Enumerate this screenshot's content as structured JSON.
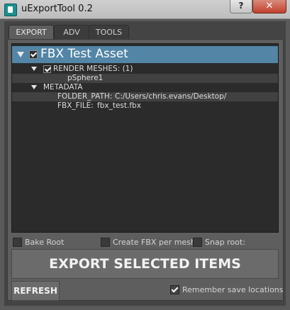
{
  "window": {
    "title": "uExportTool 0.2",
    "help_label": "?",
    "close_label": "✕"
  },
  "tabs": [
    {
      "label": "EXPORT",
      "active": true
    },
    {
      "label": "ADV",
      "active": false
    },
    {
      "label": "TOOLS",
      "active": false
    }
  ],
  "tree": {
    "root": {
      "label": "FBX Test Asset",
      "checked": true
    },
    "render_meshes": {
      "label": "RENDER MESHES: (1)",
      "checked": true
    },
    "mesh_item": "pSphere1",
    "metadata": {
      "label": "METADATA"
    },
    "folder_path": {
      "key": "FOLDER_PATH:",
      "value": "C:/Users/chris.evans/Desktop/"
    },
    "fbx_file": {
      "key": "FBX_FILE:",
      "value": "fbx_test.fbx"
    }
  },
  "options": {
    "bake_root": {
      "label": "Bake Root",
      "checked": false
    },
    "create_fbx_per_mesh": {
      "label": "Create FBX per mesh",
      "checked": false
    },
    "snap_root": {
      "label": "Snap root:",
      "checked": false
    }
  },
  "buttons": {
    "export_selected": "EXPORT SELECTED ITEMS",
    "refresh": "REFRESH"
  },
  "remember_save_locations": {
    "label": "Remember save locations",
    "checked": true
  },
  "colors": {
    "selection_highlight": "#5285a6",
    "background": "#444444"
  }
}
